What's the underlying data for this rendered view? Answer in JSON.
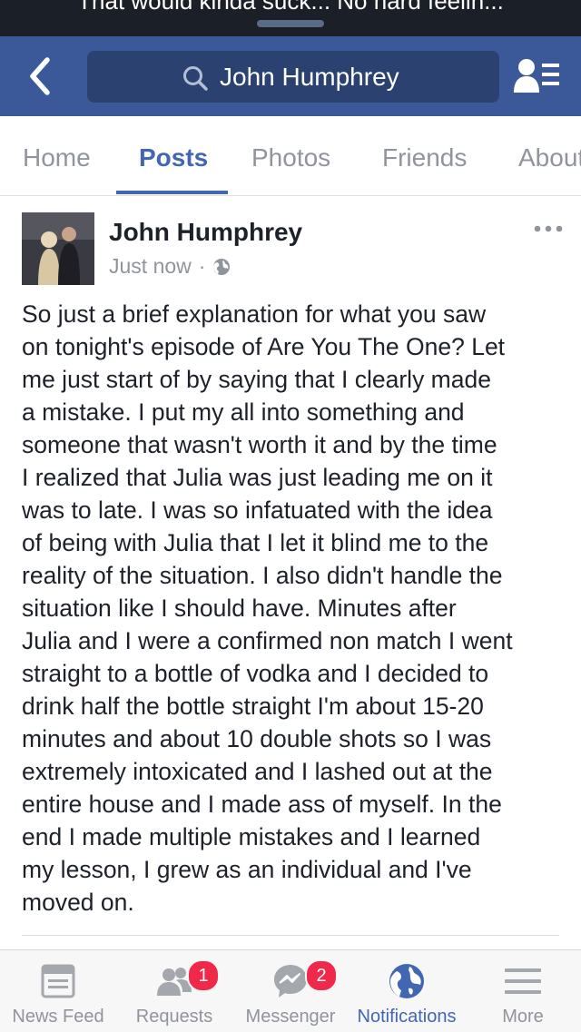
{
  "notification_banner": {
    "text": "That would kinda suck... No hard feelin..."
  },
  "navbar": {
    "search_text": "John Humphrey"
  },
  "tabs": [
    {
      "label": "Home"
    },
    {
      "label": "Posts",
      "active": true
    },
    {
      "label": "Photos"
    },
    {
      "label": "Friends"
    },
    {
      "label": "About"
    }
  ],
  "post": {
    "author": "John Humphrey",
    "timestamp": "Just now",
    "separator": "·",
    "privacy_icon": "globe-icon",
    "body": "So just a brief explanation for what you saw\non tonight's episode of Are You The One? Let\nme just start of by saying that I clearly made\na mistake. I put my all into something and\nsomeone that wasn't worth it and by the time\nI realized that Julia was just leading me on it\nwas to late. I was so infatuated with the idea\nof being with Julia that I let it blind me to the\nreality of the situation. I also didn't handle the\nsituation like I should have. Minutes after\nJulia and I were a confirmed non match I went\nstraight to a bottle of vodka and I decided to\ndrink half the bottle straight I'm about 15-20\nminutes and about 10 double shots so I was\nextremely intoxicated and I lashed out at the\nentire house and I made ass of myself. In the\nend I made multiple mistakes and I learned\nmy lesson, I grew as an individual and I've\nmoved on."
  },
  "bottom_nav": [
    {
      "label": "News Feed",
      "icon": "news-feed-icon"
    },
    {
      "label": "Requests",
      "icon": "friend-requests-icon",
      "badge": "1"
    },
    {
      "label": "Messenger",
      "icon": "messenger-icon",
      "badge": "2"
    },
    {
      "label": "Notifications",
      "icon": "globe-icon",
      "active": true
    },
    {
      "label": "More",
      "icon": "menu-icon"
    }
  ],
  "colors": {
    "brand": "#3b5998",
    "accent": "#4267b2",
    "badge": "#f02849",
    "muted": "#90949c"
  }
}
